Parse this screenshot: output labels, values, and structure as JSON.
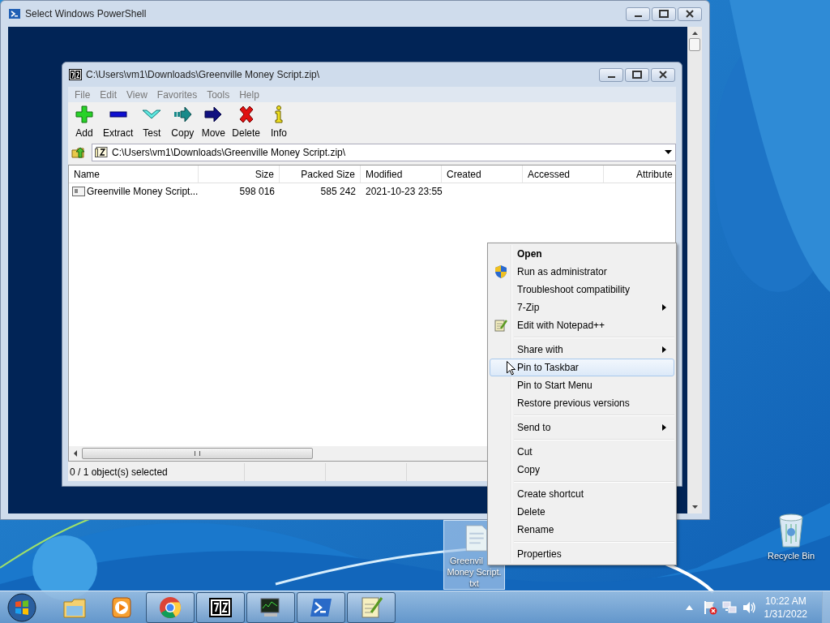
{
  "powershell_window": {
    "title": "Select Windows PowerShell"
  },
  "zip_window": {
    "title": "C:\\Users\\vm1\\Downloads\\Greenville Money Script.zip\\",
    "menu": [
      "File",
      "Edit",
      "View",
      "Favorites",
      "Tools",
      "Help"
    ],
    "toolbar": [
      {
        "kind": "add",
        "label": "Add"
      },
      {
        "kind": "extract",
        "label": "Extract"
      },
      {
        "kind": "test",
        "label": "Test"
      },
      {
        "kind": "copy",
        "label": "Copy"
      },
      {
        "kind": "move",
        "label": "Move"
      },
      {
        "kind": "delete",
        "label": "Delete"
      },
      {
        "kind": "info",
        "label": "Info"
      }
    ],
    "address": "C:\\Users\\vm1\\Downloads\\Greenville Money Script.zip\\",
    "columns": [
      {
        "label": "Name"
      },
      {
        "label": "Size"
      },
      {
        "label": "Packed Size"
      },
      {
        "label": "Modified"
      },
      {
        "label": "Created"
      },
      {
        "label": "Accessed"
      },
      {
        "label": "Attribute"
      }
    ],
    "rows": [
      {
        "cells": [
          "Greenville Money Script...",
          "598 016",
          "585 242",
          "2021-10-23 23:55"
        ]
      }
    ],
    "status": "0 / 1 object(s) selected"
  },
  "context_menu": {
    "items": [
      {
        "kind": "item",
        "label": "Open",
        "default": true,
        "selected": false,
        "submenu": false
      },
      {
        "kind": "shield",
        "label": "Run as administrator",
        "default": false,
        "selected": false,
        "submenu": false
      },
      {
        "kind": "item",
        "label": "Troubleshoot compatibility",
        "default": false,
        "selected": false,
        "submenu": false
      },
      {
        "kind": "item",
        "label": "7-Zip",
        "default": false,
        "selected": false,
        "submenu": true
      },
      {
        "kind": "notepad",
        "label": "Edit with Notepad++",
        "default": false,
        "selected": false,
        "submenu": false
      },
      {
        "kind": "separator"
      },
      {
        "kind": "item",
        "label": "Share with",
        "default": false,
        "selected": false,
        "submenu": true
      },
      {
        "kind": "item",
        "label": "Pin to Taskbar",
        "default": false,
        "selected": true,
        "submenu": false
      },
      {
        "kind": "item",
        "label": "Pin to Start Menu",
        "default": false,
        "selected": false,
        "submenu": false
      },
      {
        "kind": "item",
        "label": "Restore previous versions",
        "default": false,
        "selected": false,
        "submenu": false
      },
      {
        "kind": "separator"
      },
      {
        "kind": "item",
        "label": "Send to",
        "default": false,
        "selected": false,
        "submenu": true
      },
      {
        "kind": "separator"
      },
      {
        "kind": "item",
        "label": "Cut",
        "default": false,
        "selected": false,
        "submenu": false
      },
      {
        "kind": "item",
        "label": "Copy",
        "default": false,
        "selected": false,
        "submenu": false
      },
      {
        "kind": "separator"
      },
      {
        "kind": "item",
        "label": "Create shortcut",
        "default": false,
        "selected": false,
        "submenu": false
      },
      {
        "kind": "item",
        "label": "Delete",
        "default": false,
        "selected": false,
        "submenu": false
      },
      {
        "kind": "item",
        "label": "Rename",
        "default": false,
        "selected": false,
        "submenu": false
      },
      {
        "kind": "separator"
      },
      {
        "kind": "item",
        "label": "Properties",
        "default": false,
        "selected": false,
        "submenu": false
      }
    ]
  },
  "desktop_icons": [
    {
      "kind": "text-file",
      "label_lines": [
        "Greenvil",
        "Money Script.",
        "txt"
      ],
      "selected": true
    },
    {
      "kind": "recycle-bin",
      "label_lines": [
        "Recycle Bin"
      ],
      "selected": false
    }
  ],
  "taskbar": {
    "buttons": [
      {
        "kind": "explorer",
        "running": false
      },
      {
        "kind": "media",
        "running": false
      },
      {
        "kind": "chrome",
        "running": true
      },
      {
        "kind": "sevenzip",
        "running": true
      },
      {
        "kind": "monitor",
        "running": true
      },
      {
        "kind": "powershell",
        "running": true
      },
      {
        "kind": "notepad",
        "running": true
      }
    ],
    "clock": {
      "time": "10:22 AM",
      "date": "1/31/2022"
    }
  }
}
